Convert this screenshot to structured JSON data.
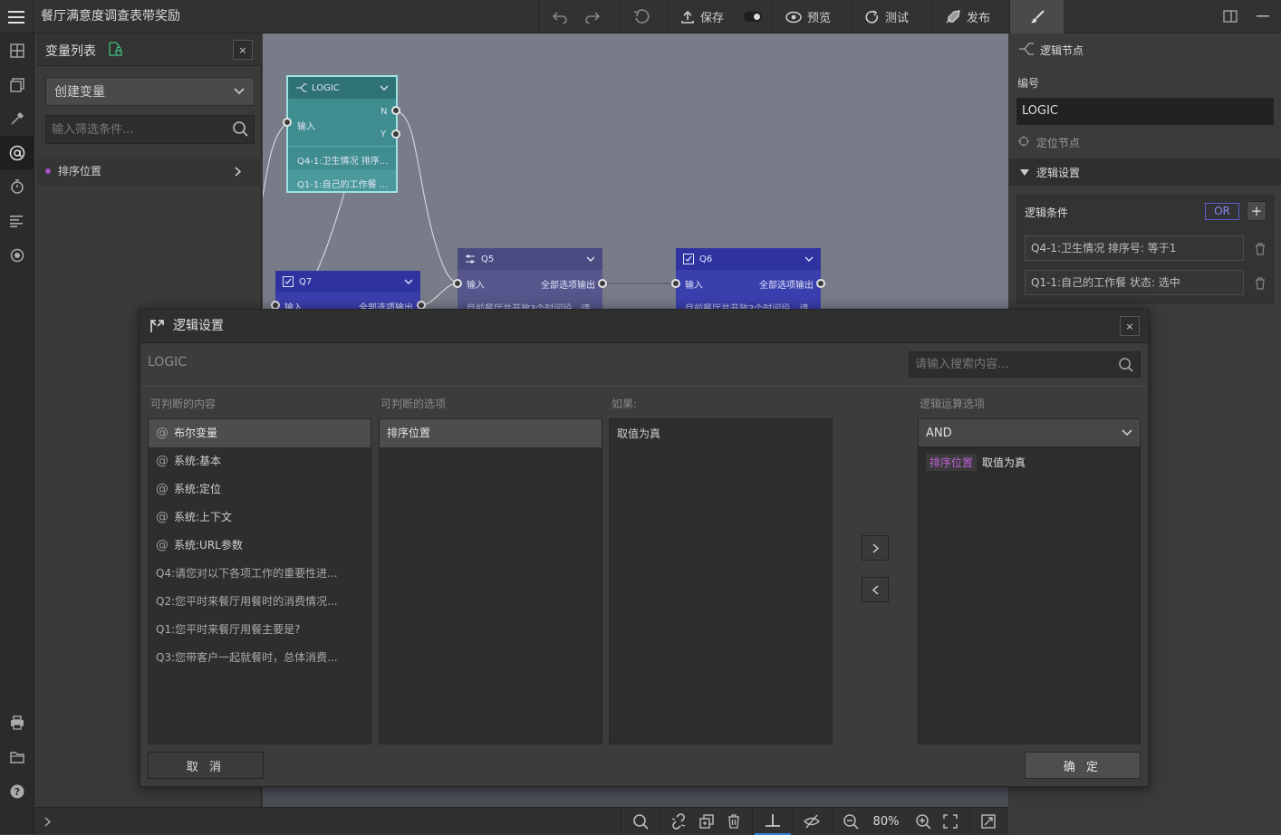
{
  "app": {
    "title": "餐厅满意度调查表带奖励"
  },
  "toolbar": {
    "save_label": "保存",
    "preview_label": "预览",
    "test_label": "测试",
    "publish_label": "发布"
  },
  "var_panel": {
    "title": "变量列表",
    "close_label": "×",
    "create_label": "创建变量",
    "filter_placeholder": "输入筛选条件...",
    "items": [
      {
        "label": "排序位置"
      }
    ]
  },
  "canvas": {
    "nodes": [
      {
        "id": "logic",
        "title": "LOGIC",
        "input_label": "输入",
        "out_n": "N",
        "out_y": "Y",
        "rows": [
          "Q4-1:卫生情况 排序...",
          "Q1-1:自己的工作餐 ..."
        ]
      },
      {
        "id": "q7",
        "title": "Q7",
        "input_label": "输入",
        "output_label": "全部选项输出"
      },
      {
        "id": "q5",
        "title": "Q5",
        "input_label": "输入",
        "output_label": "全部选项输出",
        "row": "目前餐厅共开放3个时间段，请"
      },
      {
        "id": "q6",
        "title": "Q6",
        "input_label": "输入",
        "output_label": "全部选项输出",
        "row": "目前餐厅共开放3个时间段，请"
      }
    ]
  },
  "right_panel": {
    "header": "逻辑节点",
    "id_label": "编号",
    "id_value": "LOGIC",
    "locate_label": "定位节点",
    "section_label": "逻辑设置",
    "conditions_label": "逻辑条件",
    "or_label": "OR",
    "add_label": "+",
    "conditions": [
      {
        "text": "Q4-1:卫生情况 排序号: 等于1"
      },
      {
        "text": "Q1-1:自己的工作餐 状态: 选中"
      }
    ]
  },
  "bottom_bar": {
    "zoom": "80%"
  },
  "dialog": {
    "title": "逻辑设置",
    "close_label": "×",
    "node_name": "LOGIC",
    "search_placeholder": "请输入搜索内容...",
    "col1_label": "可判断的内容",
    "col2_label": "可判断的选项",
    "col3_label": "如果:",
    "col4_label": "逻辑运算选项",
    "content_items": [
      {
        "label": "布尔变量",
        "icon": "at-icon"
      },
      {
        "label": "系统:基本",
        "icon": "at-icon"
      },
      {
        "label": "系统:定位",
        "icon": "at-icon"
      },
      {
        "label": "系统:上下文",
        "icon": "at-icon"
      },
      {
        "label": "系统:URL参数",
        "icon": "at-icon"
      },
      {
        "label": "Q4:请您对以下各项工作的重要性进..."
      },
      {
        "label": "Q2:您平时来餐厅用餐时的消费情况..."
      },
      {
        "label": "Q1:您平时来餐厅用餐主要是?"
      },
      {
        "label": "Q3:您带客户一起就餐时，总体消费..."
      }
    ],
    "option_items": [
      {
        "label": "排序位置"
      }
    ],
    "if_items": [
      {
        "label": "取值为真"
      }
    ],
    "operator": "AND",
    "expression": {
      "variable": "排序位置",
      "condition": "取值为真"
    },
    "cancel_label": "取 消",
    "ok_label": "确 定",
    "accent_color": "#c05fd8"
  }
}
